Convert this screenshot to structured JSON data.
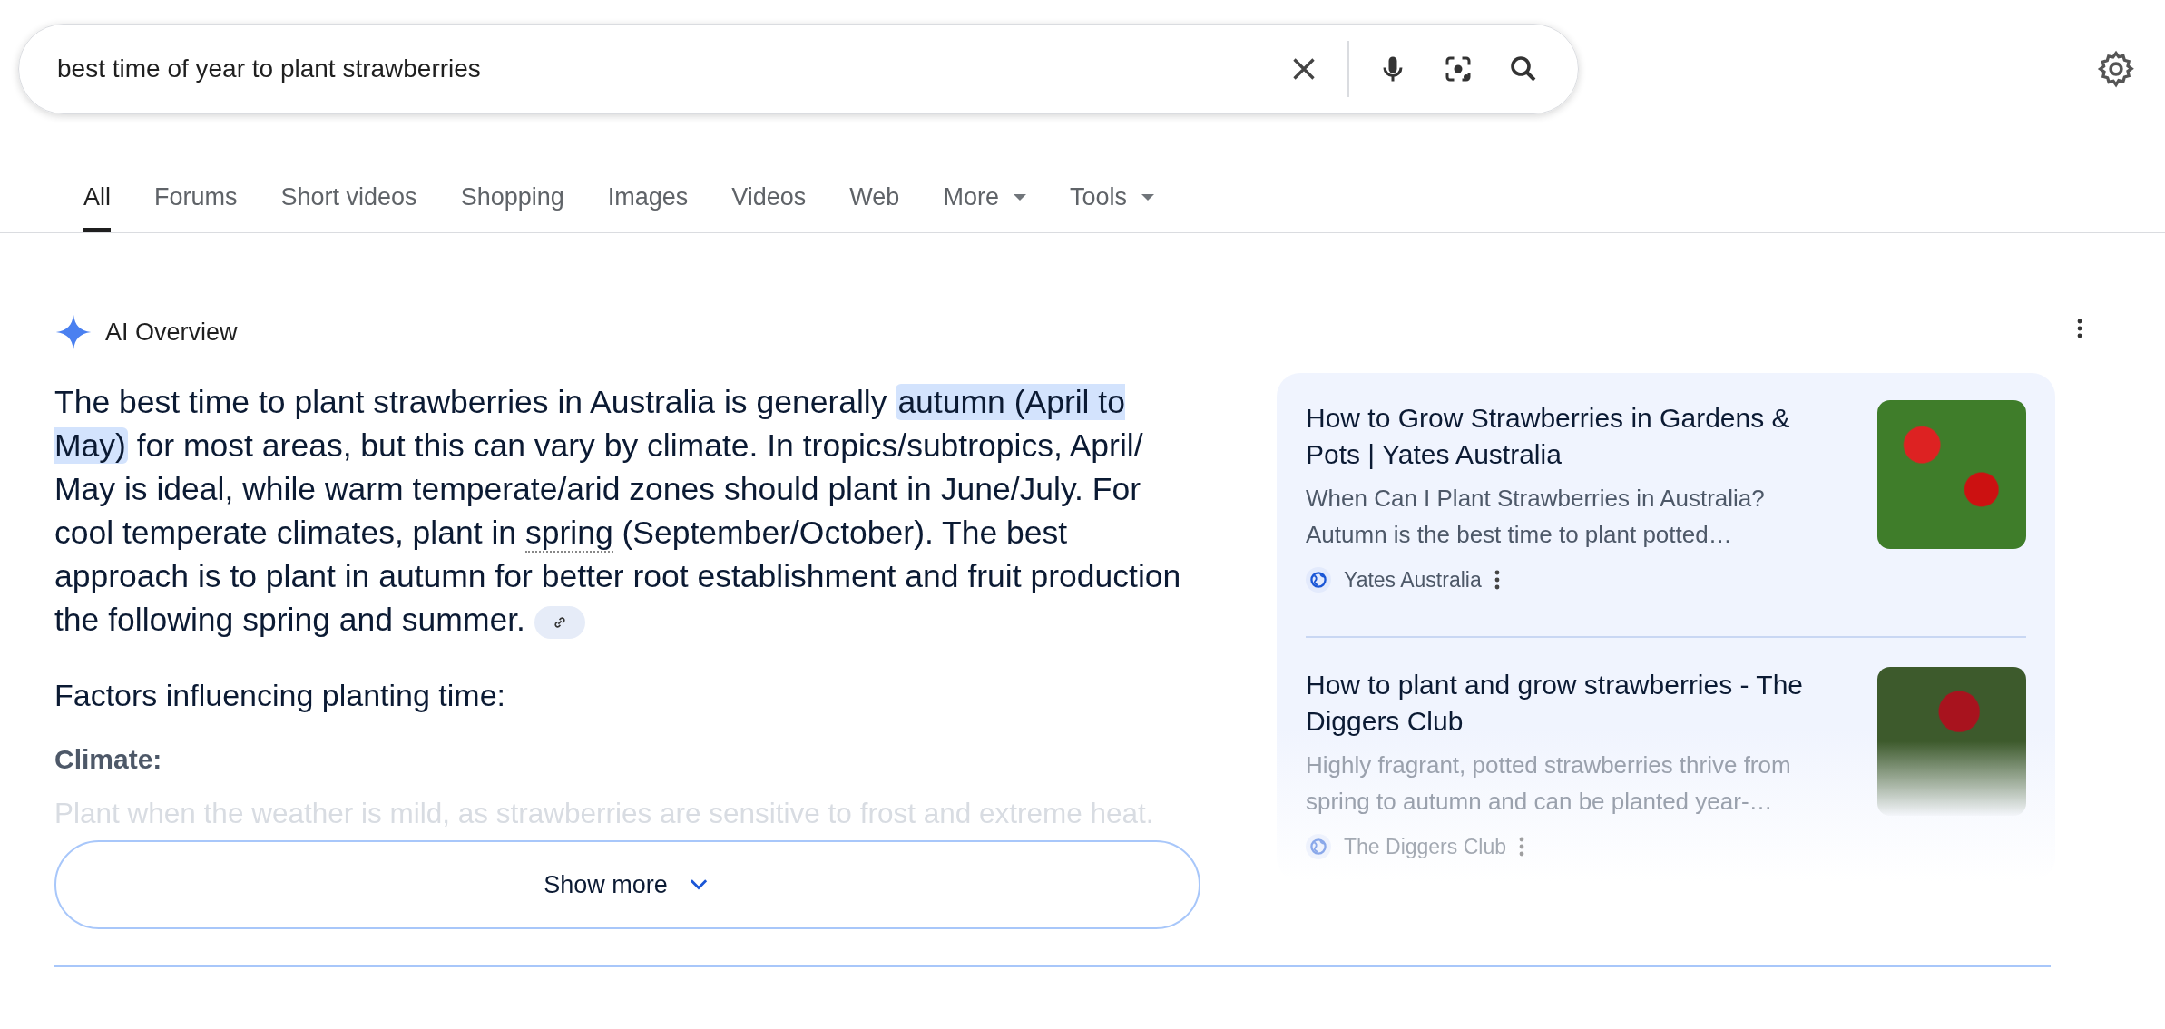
{
  "search": {
    "value": "best time of year to plant strawberries"
  },
  "tabs": [
    {
      "label": "All",
      "selected": true,
      "dropdown": false
    },
    {
      "label": "Forums",
      "selected": false,
      "dropdown": false
    },
    {
      "label": "Short videos",
      "selected": false,
      "dropdown": false
    },
    {
      "label": "Shopping",
      "selected": false,
      "dropdown": false
    },
    {
      "label": "Images",
      "selected": false,
      "dropdown": false
    },
    {
      "label": "Videos",
      "selected": false,
      "dropdown": false
    },
    {
      "label": "Web",
      "selected": false,
      "dropdown": false
    },
    {
      "label": "More",
      "selected": false,
      "dropdown": true
    },
    {
      "label": "Tools",
      "selected": false,
      "dropdown": true
    }
  ],
  "ai_overview": {
    "title": "AI Overview",
    "paragraph": [
      {
        "kind": "plain",
        "text": "The best time to plant strawberries in Australia is generally "
      },
      {
        "kind": "highlight",
        "text": "autumn (April to May)"
      },
      {
        "kind": "plain",
        "text": " for most areas, but this can vary by climate. In tropics/subtropics, April/ May is ideal, while warm temperate/arid zones should plant in June/July. For cool temperate climates, plant in "
      },
      {
        "kind": "dotted",
        "text": "spring"
      },
      {
        "kind": "plain",
        "text": " (September/October). The best approach is to plant in autumn for better root establishment and fruit production the following spring and summer."
      }
    ],
    "heading": "Factors influencing planting time:",
    "factor_label": "Climate:",
    "factor_text": "Plant when the weather is mild, as strawberries are sensitive to frost and extreme heat.",
    "show_more": "Show more",
    "sources": [
      {
        "title": "How to Grow Strawberries in Gardens & Pots | Yates Australia",
        "snippet": "When Can I Plant Strawberries in Australia? Autumn is the best time to plant potted…",
        "site": "Yates Australia",
        "faded": false
      },
      {
        "title": "How to plant and grow strawberries - The Diggers Club",
        "snippet": "Highly fragrant, potted strawberries thrive from spring to autumn and can be planted year-…",
        "site": "The Diggers Club",
        "faded": true
      }
    ]
  }
}
